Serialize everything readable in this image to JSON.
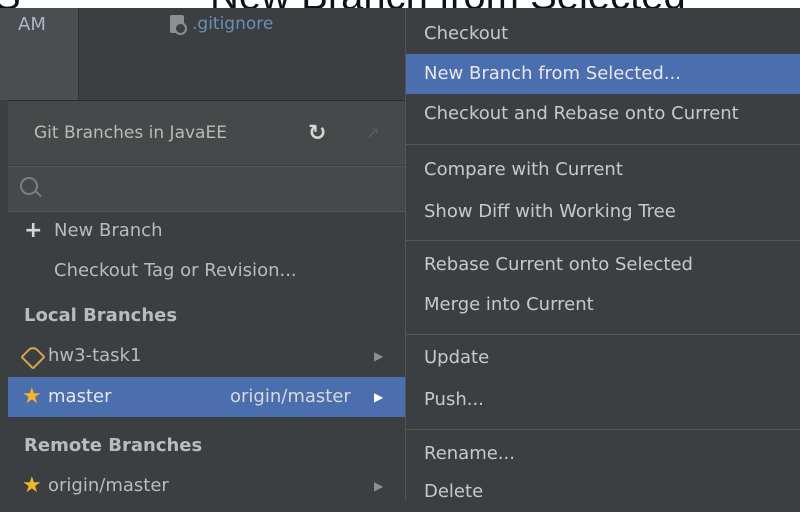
{
  "caption": {
    "left_fragment": "S",
    "main_text": "New Branch from Selected"
  },
  "editor_tabs": {
    "time_tab": "AM",
    "file_tab": ".gitignore"
  },
  "branches_popup": {
    "title": "Git Branches in JavaEE",
    "search_placeholder": "",
    "actions": [
      {
        "label": "New Branch"
      },
      {
        "label": "Checkout Tag or Revision..."
      }
    ],
    "local_section": "Local Branches",
    "local_branches": [
      {
        "name": "hw3-task1",
        "icon": "tag-icon"
      },
      {
        "name": "master",
        "icon": "star-icon",
        "tracking": "origin/master"
      }
    ],
    "remote_section": "Remote Branches",
    "remote_branches": [
      {
        "name": "origin/master",
        "icon": "star-icon"
      }
    ]
  },
  "context_menu": {
    "items": [
      {
        "label": "Checkout"
      },
      {
        "label": "New Branch from Selected..."
      },
      {
        "label": "Checkout and Rebase onto Current"
      },
      {
        "label": "Compare with Current"
      },
      {
        "label": "Show Diff with Working Tree"
      },
      {
        "label": "Rebase Current onto Selected"
      },
      {
        "label": "Merge into Current"
      },
      {
        "label": "Update"
      },
      {
        "label": "Push..."
      },
      {
        "label": "Rename..."
      },
      {
        "label": "Delete"
      }
    ]
  },
  "colors": {
    "background": "#3c3f41",
    "selection": "#4b6eaf",
    "star": "#f0b729",
    "tag": "#d7a34a",
    "file_link": "#6a8fb5"
  }
}
